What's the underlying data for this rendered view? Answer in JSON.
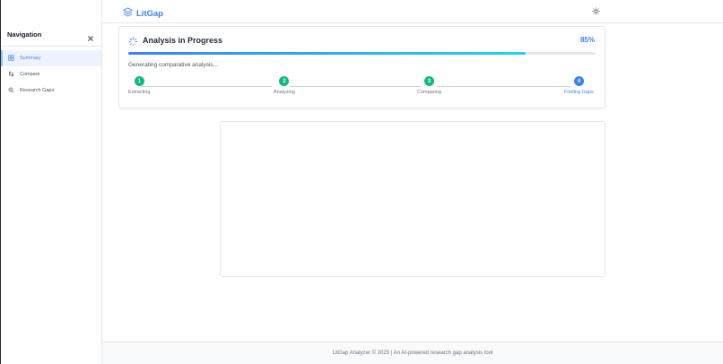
{
  "header": {
    "brand": "LitGap",
    "brand_icon": "layers-icon",
    "theme_icon": "sun-icon"
  },
  "sidebar": {
    "title": "Navigation",
    "close_icon": "close-icon",
    "items": [
      {
        "label": "Summary",
        "icon": "grid-icon",
        "active": true
      },
      {
        "label": "Compare",
        "icon": "compare-arrows-icon",
        "active": false
      },
      {
        "label": "Research Gaps",
        "icon": "search-icon",
        "active": false
      }
    ]
  },
  "progress": {
    "title": "Analysis in Progress",
    "percent_label": "85%",
    "percent": 85,
    "status": "Generating comparative analysis...",
    "steps": [
      {
        "number": "1",
        "label": "Extracting",
        "state": "done"
      },
      {
        "number": "2",
        "label": "Analyzing",
        "state": "done"
      },
      {
        "number": "3",
        "label": "Comparing",
        "state": "done"
      },
      {
        "number": "4",
        "label": "Finding Gaps",
        "state": "current"
      }
    ]
  },
  "footer": {
    "text": "LitGap Analyzer © 2025 | An AI-powered research gap analysis tool"
  },
  "colors": {
    "accent": "#3b82f6",
    "success": "#10b981",
    "progress_end": "#22d3ee"
  }
}
